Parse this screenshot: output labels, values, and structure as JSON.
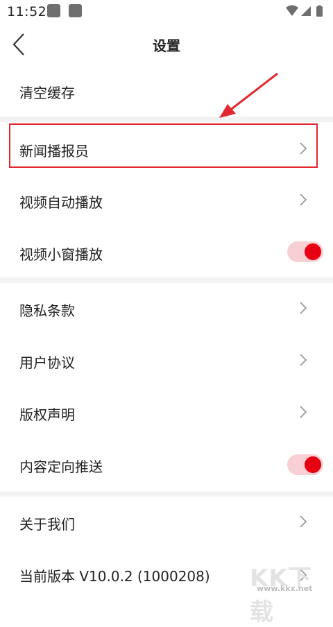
{
  "status_bar": {
    "time": "11:52"
  },
  "nav": {
    "title": "设置",
    "back_icon": "back-chevron-icon"
  },
  "rows": {
    "clear_cache": "清空缓存",
    "news_anchor": "新闻播报员",
    "video_autoplay": "视频自动播放",
    "video_small_window": "视频小窗播放",
    "privacy": "隐私条款",
    "user_agreement": "用户协议",
    "copyright": "版权声明",
    "content_push": "内容定向推送",
    "about": "关于我们",
    "version": "当前版本 V10.0.2 (1000208)"
  },
  "toggles": {
    "video_small_window": "on",
    "content_push": "on"
  },
  "watermark": {
    "text": "KK下载",
    "url": "www.kkx.net"
  },
  "colors": {
    "accent": "#e60012",
    "toggle_track": "#f8cfd3",
    "highlight": "#e3262f",
    "gap": "#f2f2f2"
  }
}
